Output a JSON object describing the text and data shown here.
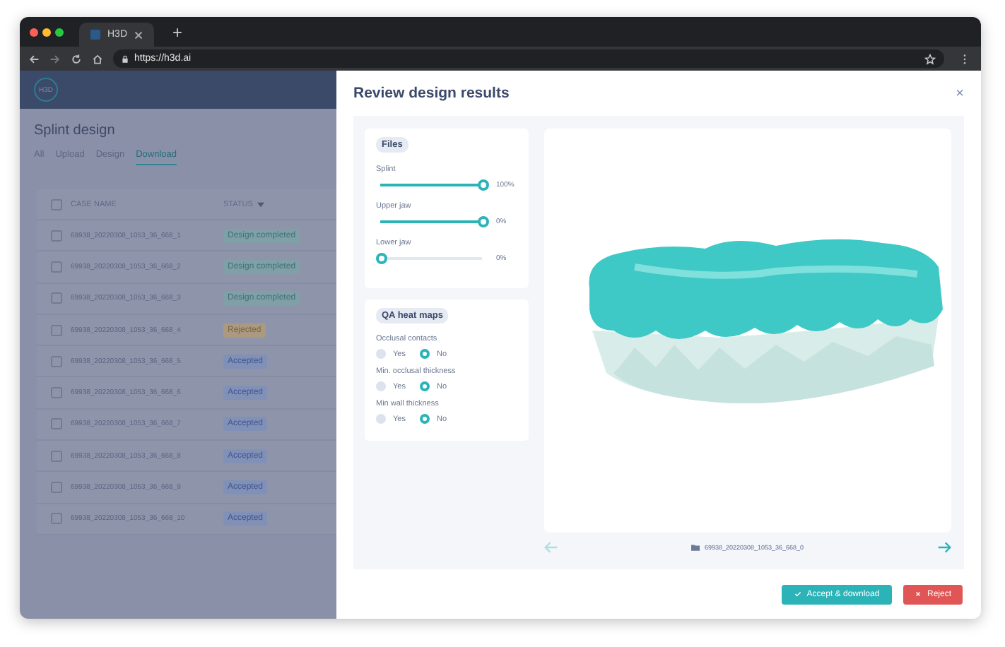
{
  "browser": {
    "tab_title": "H3D",
    "new_tab": "+",
    "url": "https://h3d.ai"
  },
  "app": {
    "logo": "H3D",
    "title": "Splint design",
    "tabs": [
      {
        "label": "All",
        "selected": false
      },
      {
        "label": "Upload",
        "selected": false
      },
      {
        "label": "Design",
        "selected": false
      },
      {
        "label": "Download",
        "selected": true
      }
    ],
    "table": {
      "select_all_checked": false,
      "columns": [
        "CASE NAME",
        "STATUS"
      ],
      "rows": [
        {
          "name": "69938_20220308_1053_36_668_1",
          "status": "Design completed",
          "kind": "completed",
          "checked": false
        },
        {
          "name": "69938_20220308_1053_36_668_2",
          "status": "Design completed",
          "kind": "completed",
          "checked": false
        },
        {
          "name": "69938_20220308_1053_36_668_3",
          "status": "Design completed",
          "kind": "completed",
          "checked": false
        },
        {
          "name": "69938_20220308_1053_36_668_4",
          "status": "Rejected",
          "kind": "rejected",
          "checked": false
        },
        {
          "name": "69938_20220308_1053_36_668_5",
          "status": "Accepted",
          "kind": "accepted",
          "checked": false
        },
        {
          "name": "69938_20220308_1053_36_668_6",
          "status": "Accepted",
          "kind": "accepted",
          "checked": false
        },
        {
          "name": "69938_20220308_1053_36_668_7",
          "status": "Accepted",
          "kind": "accepted",
          "checked": false
        },
        {
          "name": "69938_20220308_1053_36_668_8",
          "status": "Accepted",
          "kind": "accepted",
          "checked": false
        },
        {
          "name": "69938_20220308_1053_36_668_9",
          "status": "Accepted",
          "kind": "accepted",
          "checked": false
        },
        {
          "name": "69938_20220308_1053_36_668_10",
          "status": "Accepted",
          "kind": "accepted",
          "checked": false
        }
      ]
    }
  },
  "modal": {
    "title": "Review design results",
    "close": "×",
    "files": {
      "title": "Files",
      "sliders": [
        {
          "label": "Splint",
          "level": 1,
          "reading": "100%"
        },
        {
          "label": "Upper jaw",
          "level": 1,
          "reading": "0%"
        },
        {
          "label": "Lower jaw",
          "level": 0,
          "reading": "0%"
        }
      ]
    },
    "heat_maps": {
      "title": "QA heat maps",
      "groups": [
        {
          "label": "Occlusal contacts",
          "options": [
            {
              "label": "Yes",
              "selected": false
            },
            {
              "label": "No",
              "selected": true
            }
          ]
        },
        {
          "label": "Min. occlusal thickness",
          "options": [
            {
              "label": "Yes",
              "selected": false
            },
            {
              "label": "No",
              "selected": true
            }
          ]
        },
        {
          "label": "Min wall thickness",
          "options": [
            {
              "label": "Yes",
              "selected": false
            },
            {
              "label": "No",
              "selected": true
            }
          ]
        }
      ]
    },
    "viewer": {
      "file_name": "69938_20220308_1053_36_668_0",
      "prev_disabled": true,
      "next_disabled": false
    },
    "buttons": [
      {
        "label": "Accept & download",
        "kind": "accept"
      },
      {
        "label": "Reject",
        "kind": "reject"
      }
    ]
  }
}
